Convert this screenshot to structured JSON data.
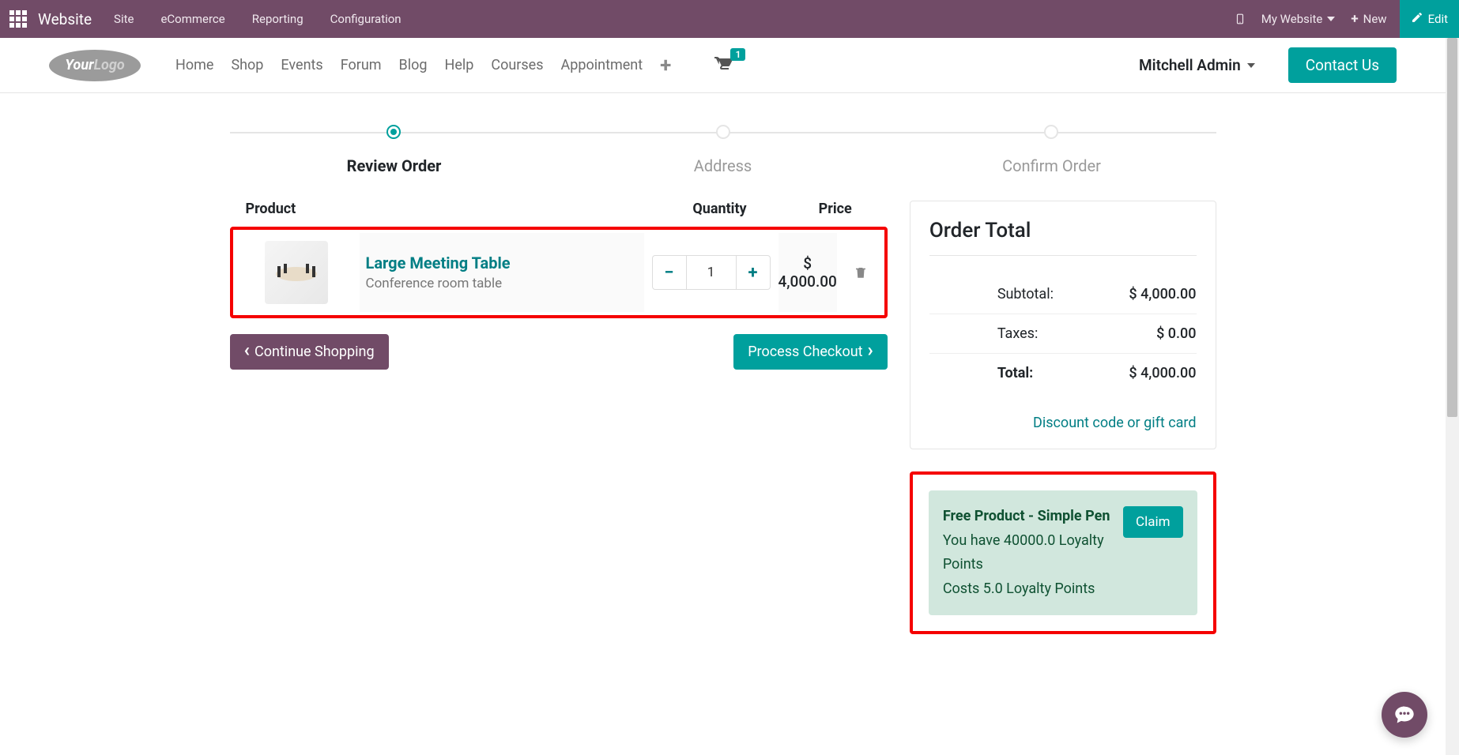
{
  "topbar": {
    "brand": "Website",
    "menu": [
      "Site",
      "eCommerce",
      "Reporting",
      "Configuration"
    ],
    "my_website": "My Website",
    "new_label": "New",
    "edit_label": "Edit"
  },
  "sitenav": {
    "links": [
      "Home",
      "Shop",
      "Events",
      "Forum",
      "Blog",
      "Help",
      "Courses",
      "Appointment"
    ],
    "cart_count": "1",
    "user": "Mitchell Admin",
    "contact": "Contact Us"
  },
  "steps": {
    "labels": [
      "Review Order",
      "Address",
      "Confirm Order"
    ],
    "active_index": 0
  },
  "cart": {
    "headers": {
      "product": "Product",
      "quantity": "Quantity",
      "price": "Price"
    },
    "items": [
      {
        "name": "Large Meeting Table",
        "desc": "Conference room table",
        "qty": "1",
        "price": "$ 4,000.00"
      }
    ],
    "continue": "Continue Shopping",
    "checkout": "Process Checkout"
  },
  "totals": {
    "title": "Order Total",
    "subtotal_label": "Subtotal:",
    "subtotal_val": "$ 4,000.00",
    "taxes_label": "Taxes:",
    "taxes_val": "$ 0.00",
    "total_label": "Total:",
    "total_val": "$ 4,000.00",
    "discount_link": "Discount code or gift card"
  },
  "reward": {
    "title": "Free Product - Simple Pen",
    "line1": "You have 40000.0 Loyalty Points",
    "line2": "Costs 5.0 Loyalty Points",
    "claim": "Claim"
  }
}
